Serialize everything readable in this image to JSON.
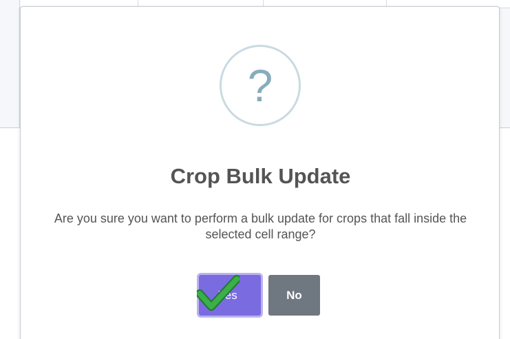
{
  "dialog": {
    "icon": "question-mark-icon",
    "icon_glyph": "?",
    "title": "Crop Bulk Update",
    "message": "Are you sure you want to perform a bulk update for crops that fall inside the selected cell range?",
    "confirm_label": "Yes",
    "cancel_label": "No",
    "annotation_icon": "green-checkmark-icon"
  },
  "colors": {
    "confirm_button": "#7a6be0",
    "cancel_button": "#6f7780",
    "question_icon": "#87adbd",
    "text": "#545454",
    "checkmark": "#3cae4a"
  }
}
